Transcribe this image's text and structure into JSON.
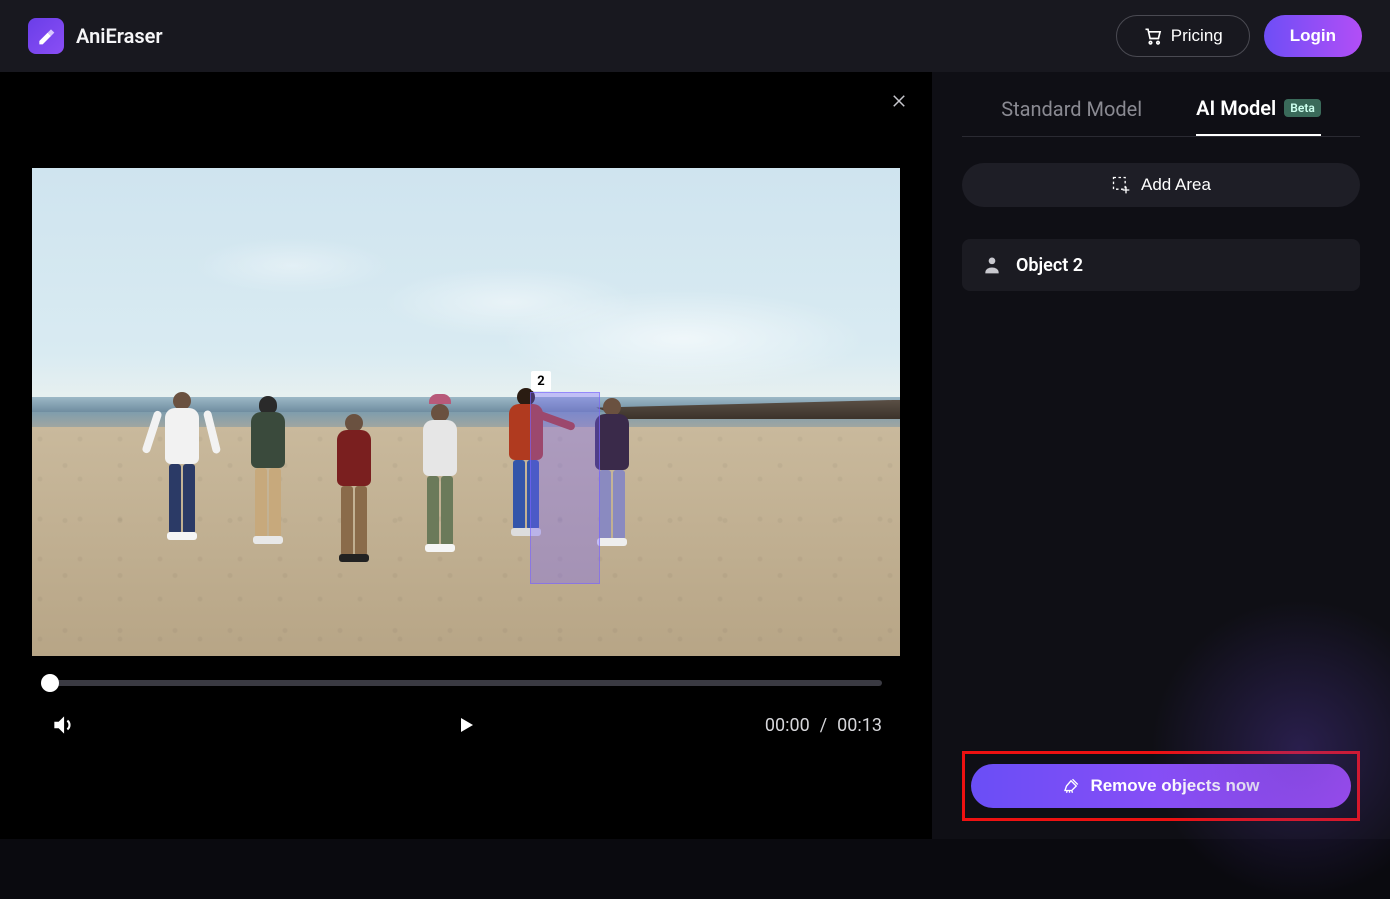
{
  "header": {
    "brand": "AniEraser",
    "pricing_label": "Pricing",
    "login_label": "Login"
  },
  "editor": {
    "selection": {
      "label": "2"
    },
    "player": {
      "current_time": "00:00",
      "duration": "00:13",
      "separator": " / "
    }
  },
  "sidebar": {
    "tabs": {
      "standard": "Standard Model",
      "ai": "AI Model",
      "beta_badge": "Beta"
    },
    "add_area_label": "Add Area",
    "objects": [
      {
        "label": "Object 2"
      }
    ],
    "remove_label": "Remove objects now"
  },
  "colors": {
    "accent_gradient_from": "#6a4ef6",
    "accent_gradient_to": "#a24ef6",
    "highlight_border": "#e11"
  }
}
